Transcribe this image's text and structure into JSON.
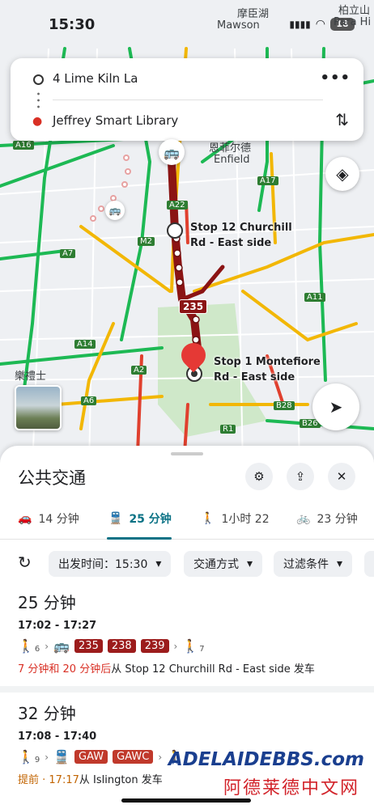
{
  "status_bar": {
    "time": "15:30",
    "battery": "18"
  },
  "map_labels": {
    "mawson": "Mawson",
    "mawson_zh": "摩臣湖",
    "para_hills": "Para Hi",
    "para_hills_zh": "柏立山",
    "enfield": "Enfield",
    "enfield_zh": "恩菲尔德",
    "playford_zh": "樂禮士",
    "roads": [
      "A16",
      "A17",
      "A22",
      "M2",
      "A7",
      "A11",
      "A14",
      "A2",
      "A6",
      "B28",
      "R1",
      "B26"
    ]
  },
  "search": {
    "origin": "4 Lime Kiln La",
    "destination": "Jeffrey Smart Library"
  },
  "map_stops": {
    "start_stop": "Stop 12 Churchill\nRd - East side",
    "end_stop": "Stop 1 Montefiore\nRd - East side",
    "route_badge": "235"
  },
  "sheet": {
    "title": "公共交通",
    "modes": [
      {
        "label": "14 分钟",
        "icon": "car-icon"
      },
      {
        "label": "25 分钟",
        "icon": "transit-icon"
      },
      {
        "label": "1小时 22",
        "icon": "walk-icon"
      },
      {
        "label": "23 分钟",
        "icon": "bike-icon"
      }
    ],
    "filters": {
      "depart": "出发时间：15:30",
      "mode": "交通方式",
      "filter": "过滤条件"
    }
  },
  "routes": [
    {
      "duration": "25 分钟",
      "times": "17:02 - 17:27",
      "walk_before": "6",
      "lines": [
        "235",
        "238",
        "239"
      ],
      "walk_after": "7",
      "note_highlight": "7 分钟和 20 分钟后",
      "note_rest": "从 Stop 12 Churchill Rd - East side 发车"
    },
    {
      "duration": "32 分钟",
      "times": "17:08 - 17:40",
      "walk_before": "9",
      "lines": [
        "GAW",
        "GAWC"
      ],
      "note_highlight": "提前 · 17:17",
      "note_rest": "从 Islington 发车"
    }
  ],
  "watermark": {
    "brand": "ADELAIDEBBS.com",
    "chinese": "阿德莱德中文网"
  },
  "colors": {
    "route": "#8b1414",
    "accent": "#0b7285",
    "delay_red": "#d93025",
    "early_orange": "#c26401"
  }
}
